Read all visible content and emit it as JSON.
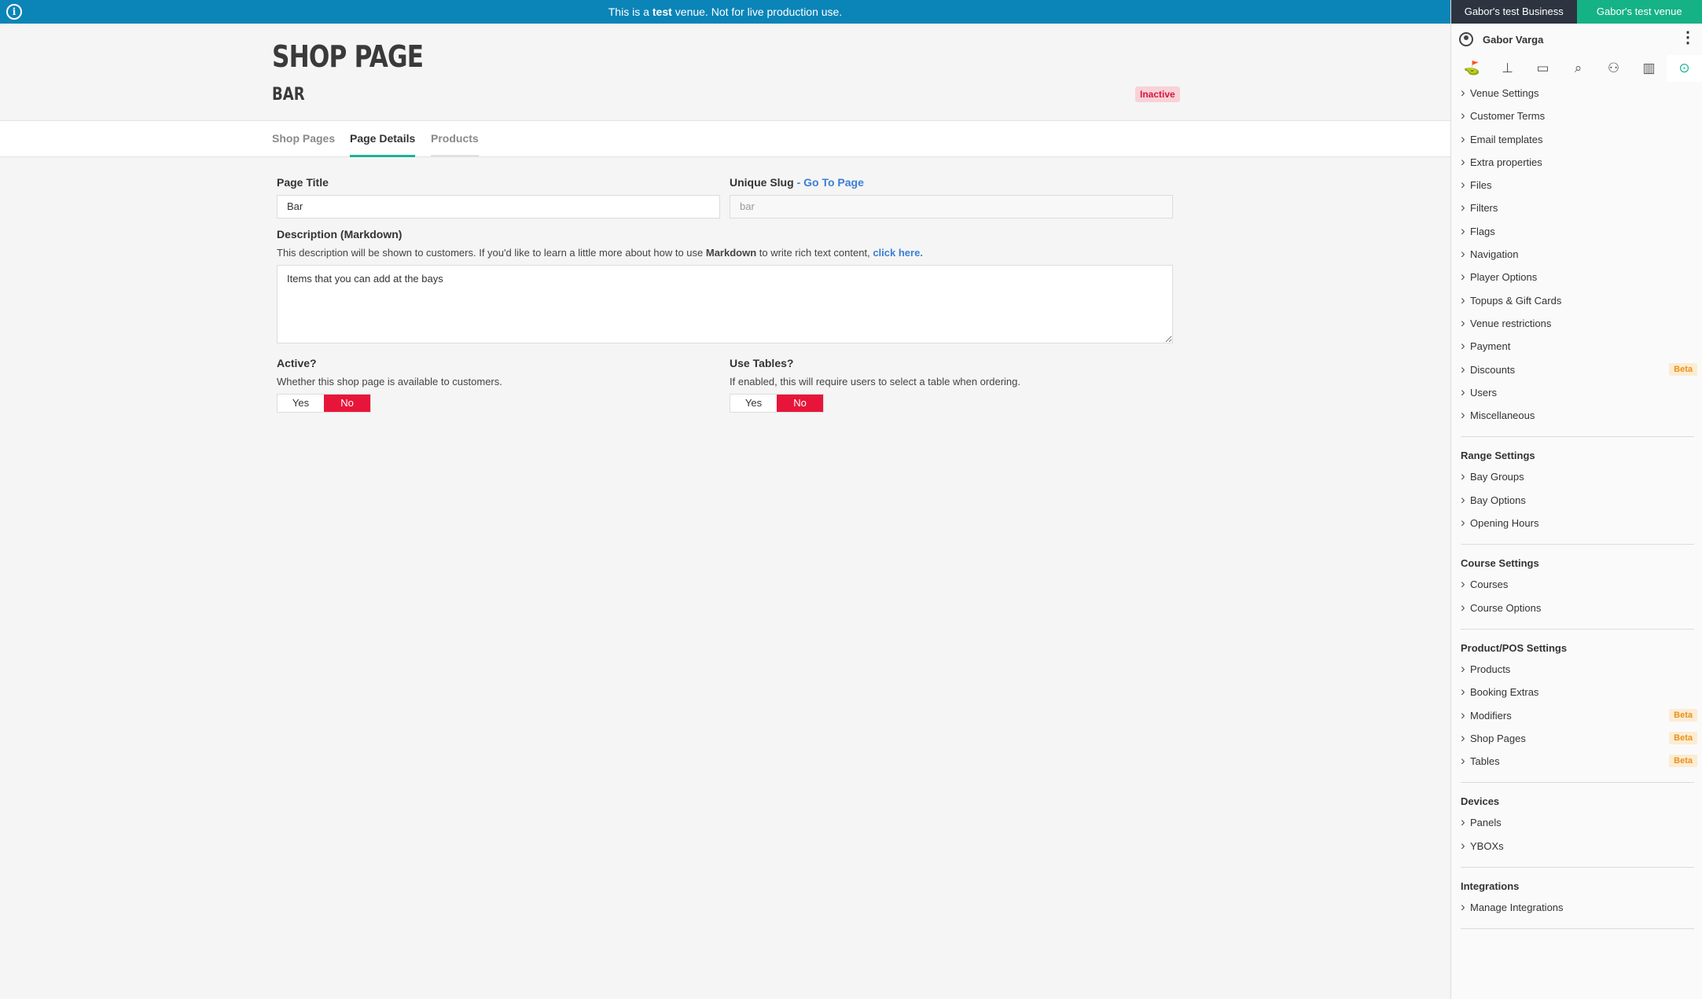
{
  "banner": {
    "pre": "This is a",
    "bold": "test",
    "post": "venue. Not for live production use."
  },
  "header": {
    "title": "SHOP PAGE",
    "subtitle": "BAR",
    "status": "Inactive"
  },
  "tabs": [
    {
      "label": "Shop Pages"
    },
    {
      "label": "Page Details"
    },
    {
      "label": "Products"
    }
  ],
  "form": {
    "page_title": {
      "label": "Page Title",
      "value": "Bar"
    },
    "slug": {
      "label": "Unique Slug",
      "link": "- Go To Page",
      "value": "bar"
    },
    "description": {
      "label": "Description (Markdown)",
      "help_pre": "This description will be shown to customers. If you'd like to learn a little more about how to use",
      "help_bold": "Markdown",
      "help_mid": "to write rich text content,",
      "help_link": "click here.",
      "value": "Items that you can add at the bays"
    },
    "active": {
      "label": "Active?",
      "help": "Whether this shop page is available to customers.",
      "yes": "Yes",
      "no": "No",
      "selected": "No"
    },
    "use_tables": {
      "label": "Use Tables?",
      "help": "If enabled, this will require users to select a table when ordering.",
      "yes": "Yes",
      "no": "No",
      "selected": "No"
    }
  },
  "sidebar": {
    "business": "Gabor's test Business",
    "venue": "Gabor's test venue",
    "user": "Gabor Varga",
    "icons": [
      "golf-shot-icon",
      "golf-tee-icon",
      "monitor-icon",
      "search-icon",
      "users-icon",
      "bar-chart-icon",
      "settings-active-icon"
    ],
    "general": [
      {
        "label": "Venue Settings"
      },
      {
        "label": "Customer Terms"
      },
      {
        "label": "Email templates"
      },
      {
        "label": "Extra properties"
      },
      {
        "label": "Files"
      },
      {
        "label": "Filters"
      },
      {
        "label": "Flags"
      },
      {
        "label": "Navigation"
      },
      {
        "label": "Player Options"
      },
      {
        "label": "Topups & Gift Cards"
      },
      {
        "label": "Venue restrictions"
      },
      {
        "label": "Payment"
      },
      {
        "label": "Discounts",
        "badge": "Beta"
      },
      {
        "label": "Users"
      },
      {
        "label": "Miscellaneous"
      }
    ],
    "range_heading": "Range Settings",
    "range": [
      {
        "label": "Bay Groups"
      },
      {
        "label": "Bay Options"
      },
      {
        "label": "Opening Hours"
      }
    ],
    "course_heading": "Course Settings",
    "course": [
      {
        "label": "Courses"
      },
      {
        "label": "Course Options"
      }
    ],
    "product_heading": "Product/POS Settings",
    "product": [
      {
        "label": "Products"
      },
      {
        "label": "Booking Extras"
      },
      {
        "label": "Modifiers",
        "badge": "Beta"
      },
      {
        "label": "Shop Pages",
        "badge": "Beta"
      },
      {
        "label": "Tables",
        "badge": "Beta"
      }
    ],
    "devices_heading": "Devices",
    "devices": [
      {
        "label": "Panels"
      },
      {
        "label": "YBOXs"
      }
    ],
    "integrations_heading": "Integrations",
    "integrations": [
      {
        "label": "Manage Integrations"
      }
    ]
  }
}
